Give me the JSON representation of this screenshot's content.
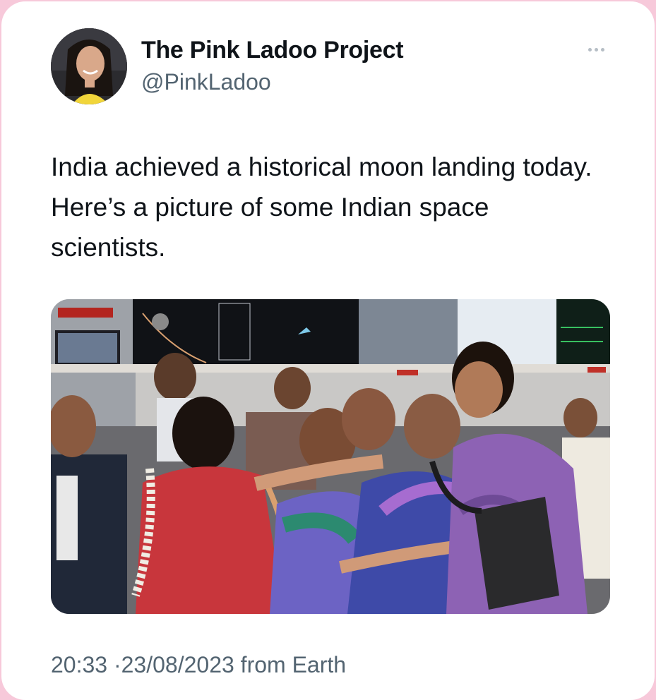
{
  "author": {
    "display_name": "The Pink Ladoo Project",
    "handle": "@PinkLadoo",
    "avatar_icon": "profile-photo"
  },
  "tweet": {
    "text": "India achieved a historical moon landing today. Here’s a picture of some Indian space scientists.",
    "media_icon": "photo-of-scientists-celebrating"
  },
  "meta": {
    "time": "20:33",
    "separator": "·",
    "date": "23/08/2023",
    "source_prefix": "from",
    "source": "Earth"
  },
  "menu": {
    "more_icon": "more-horizontal-icon"
  },
  "colors": {
    "background": "#f7c9da",
    "card": "#ffffff",
    "primary_text": "#0f1419",
    "secondary_text": "#536471"
  }
}
